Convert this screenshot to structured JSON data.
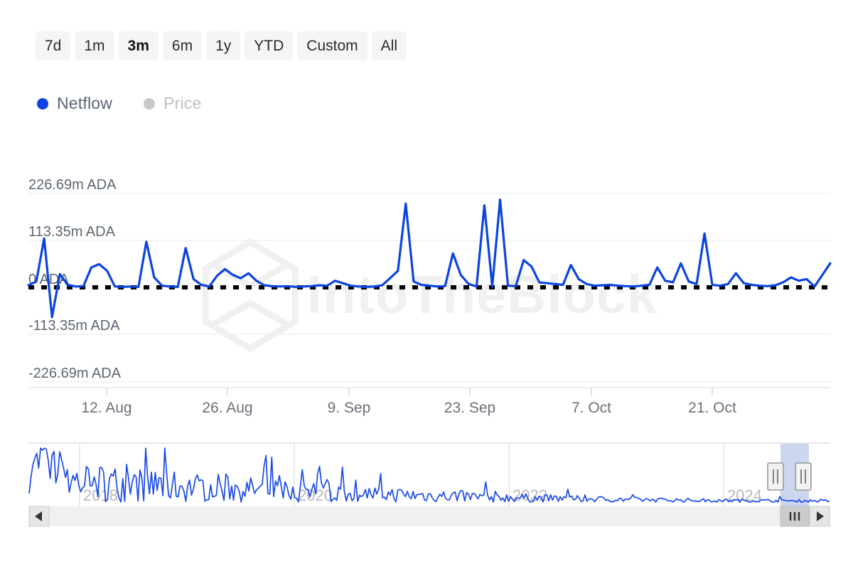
{
  "range_selector": {
    "buttons": [
      {
        "label": "7d",
        "active": false
      },
      {
        "label": "1m",
        "active": false
      },
      {
        "label": "3m",
        "active": true
      },
      {
        "label": "6m",
        "active": false
      },
      {
        "label": "1y",
        "active": false
      },
      {
        "label": "YTD",
        "active": false
      },
      {
        "label": "Custom",
        "active": false
      },
      {
        "label": "All",
        "active": false
      }
    ]
  },
  "legend": {
    "items": [
      {
        "label": "Netflow",
        "color": "#0b44e0",
        "enabled": true
      },
      {
        "label": "Price",
        "color": "#c7c9cc",
        "enabled": false
      }
    ]
  },
  "watermark": {
    "text": "IntoTheBlock",
    "color": "#f0f0f0"
  },
  "navigator": {
    "year_labels": [
      "2018",
      "2020",
      "2022",
      "2024"
    ],
    "selection_color": "#ccd7ef",
    "left_arrow_icon": "triangle-left-icon",
    "right_arrow_icon": "triangle-right-icon",
    "grip_icon": "grip-vertical-icon",
    "handle_icon": "resize-handle-icon"
  },
  "chart_data": {
    "type": "line",
    "title": "",
    "xlabel": "",
    "ylabel": "",
    "unit": "ADA",
    "line_color": "#0b44e0",
    "zero_line_color": "#000000",
    "zero_line_style": "dotted",
    "grid": true,
    "legend_position": "top-left",
    "ylim": [
      -226.69,
      226.69
    ],
    "ytick_labels": [
      "226.69m ADA",
      "113.35m ADA",
      "0 ADA",
      "-113.35m ADA",
      "-226.69m ADA"
    ],
    "ytick_values": [
      226.69,
      113.35,
      0,
      -113.35,
      -226.69
    ],
    "xtick_labels": [
      "12. Aug",
      "26. Aug",
      "9. Sep",
      "23. Sep",
      "7. Oct",
      "21. Oct"
    ],
    "series": [
      {
        "name": "Netflow",
        "values": [
          5,
          14,
          118,
          -72,
          32,
          6,
          2,
          3,
          48,
          56,
          40,
          2,
          1,
          2,
          1,
          110,
          24,
          4,
          2,
          1,
          95,
          20,
          6,
          2,
          28,
          44,
          30,
          22,
          34,
          16,
          5,
          3,
          2,
          3,
          1,
          2,
          3,
          5,
          4,
          16,
          10,
          4,
          2,
          1,
          2,
          5,
          22,
          40,
          202,
          14,
          6,
          4,
          2,
          3,
          82,
          30,
          8,
          2,
          198,
          2,
          212,
          4,
          3,
          66,
          50,
          12,
          10,
          8,
          6,
          54,
          20,
          8,
          4,
          5,
          6,
          4,
          3,
          2,
          4,
          6,
          48,
          16,
          12,
          58,
          14,
          8,
          130,
          6,
          4,
          8,
          34,
          10,
          6,
          4,
          3,
          5,
          12,
          24,
          16,
          20,
          2,
          30,
          58
        ]
      }
    ],
    "notes": "Blue netflow line with dotted zero baseline; three spikes exceed 200m ADA, one early drawdown near -72m ADA."
  }
}
